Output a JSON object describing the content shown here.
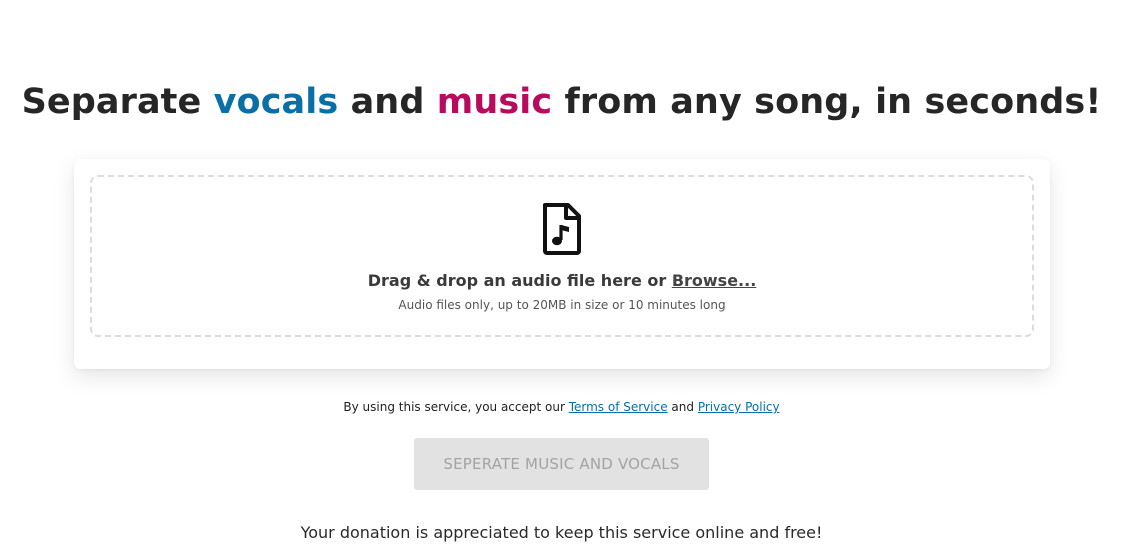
{
  "headline": {
    "part1": "Separate ",
    "vocals": "vocals",
    "part2": " and ",
    "music": "music",
    "part3": " from any song, in seconds!"
  },
  "dropzone": {
    "icon": "audio-file-icon",
    "title_prefix": "Drag & drop an audio file here or ",
    "browse_label": "Browse...",
    "subtitle": "Audio files only, up to 20MB in size or 10 minutes long"
  },
  "terms": {
    "prefix": "By using this service, you accept our ",
    "tos_label": "Terms of Service",
    "middle": " and ",
    "privacy_label": "Privacy Policy"
  },
  "separate_button": {
    "label": "SEPERATE MUSIC AND VOCALS",
    "state": "disabled"
  },
  "donation": {
    "text": "Your donation is appreciated to keep this service online and free!"
  },
  "colors": {
    "vocals": "#0a6fa6",
    "music": "#b80b5e",
    "link": "#0a6fa6",
    "button_bg": "#e2e2e2",
    "button_text": "#a3a3a3"
  }
}
